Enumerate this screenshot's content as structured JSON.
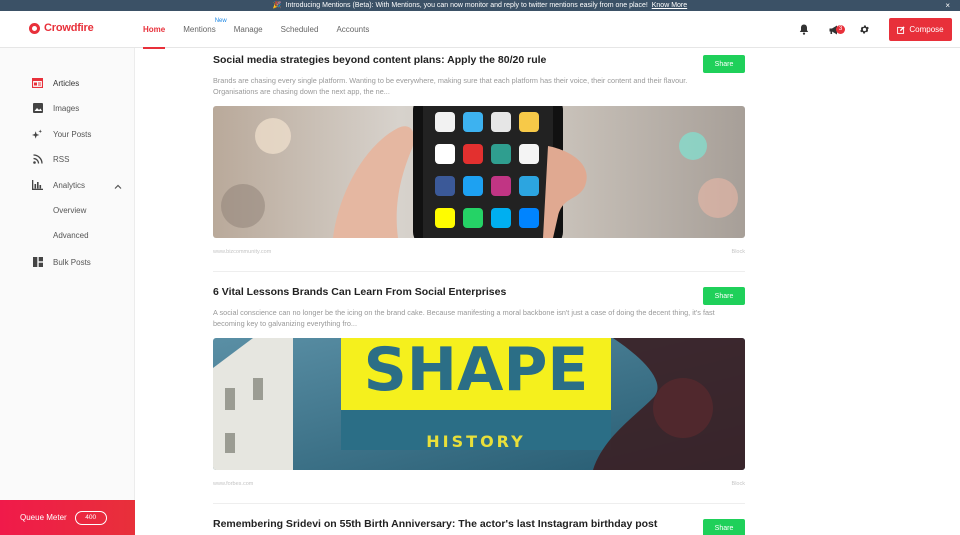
{
  "announcement": {
    "text": "Introducing Mentions (Beta): With Mentions, you can now monitor and reply to twitter mentions easily from one place!",
    "link": "Know More",
    "close": "×"
  },
  "brand": {
    "name": "Crowdfire",
    "accent": "#e8303a"
  },
  "nav": {
    "tabs": [
      {
        "label": "Home",
        "active": true
      },
      {
        "label": "Mentions",
        "badge": "New"
      },
      {
        "label": "Manage"
      },
      {
        "label": "Scheduled"
      },
      {
        "label": "Accounts"
      }
    ],
    "notifications_count": "3",
    "compose_label": "Compose"
  },
  "sidebar": {
    "items": [
      {
        "label": "Articles",
        "icon": "articles-icon",
        "active": true
      },
      {
        "label": "Images",
        "icon": "image-icon"
      },
      {
        "label": "Your Posts",
        "icon": "sparkle-icon"
      },
      {
        "label": "RSS",
        "icon": "rss-icon"
      },
      {
        "label": "Analytics",
        "icon": "bar-chart-icon"
      },
      {
        "label": "Bulk Posts",
        "icon": "bulk-icon"
      }
    ],
    "analytics_sub": [
      "Overview",
      "Advanced"
    ],
    "queue_meter": {
      "label": "Queue Meter",
      "value": "400"
    }
  },
  "feed": {
    "articles": [
      {
        "title": "Social media strategies beyond content plans: Apply the 80/20 rule",
        "description": "Brands are chasing every single platform. Wanting to be everywhere, making sure that each platform has their voice, their content and their flavour. Organisations are chasing down the next app, the ne...",
        "source": "www.bizcommunity.com",
        "tag": "Block",
        "share_label": "Share"
      },
      {
        "title": "6 Vital Lessons Brands Can Learn From Social Enterprises",
        "description": "A social conscience can no longer be the icing on the brand cake. Because manifesting a moral backbone isn't just a case of doing the decent thing, it's fast becoming key to galvanizing everything fro...",
        "source": "www.forbes.com",
        "tag": "Block",
        "share_label": "Share",
        "image_text": {
          "big": "SHAPE",
          "small": "HISTORY"
        }
      },
      {
        "title": "Remembering Sridevi on 55th Birth Anniversary: The actor's last Instagram birthday post",
        "share_label": "Share"
      }
    ]
  }
}
